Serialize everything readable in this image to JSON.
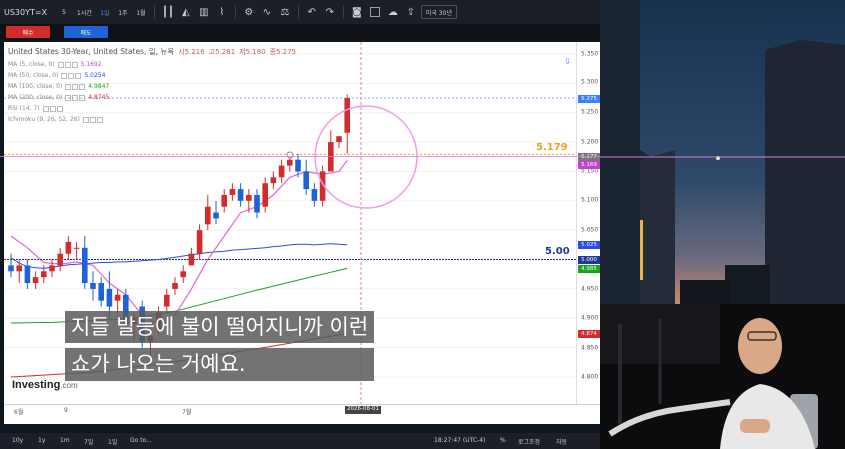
{
  "toolbar": {
    "symbol": "US30YT=X",
    "intervals": [
      "5",
      "1시간",
      "1일",
      "1주",
      "1월"
    ],
    "active_interval": "1일",
    "timezone": "미국 30년"
  },
  "trade": {
    "buy_label": "매수",
    "sell_label": "매도"
  },
  "legend": {
    "title": "United States 30-Year, United States, 일, 뉴욕",
    "open": "시5.216",
    "high": "고5.281",
    "low": "저5.180",
    "close": "종5.275",
    "indicators": [
      {
        "label": "MA (5, close, 0)",
        "value": "5.1692",
        "color": "#c33fd6"
      },
      {
        "label": "MA (50, close, 0)",
        "value": "5.0254",
        "color": "#2c4be0"
      },
      {
        "label": "MA (100, close, 0)",
        "value": "4.9847",
        "color": "#1aa31a"
      },
      {
        "label": "MA (200, close, 0)",
        "value": "4.8745",
        "color": "#d22c2c"
      },
      {
        "label": "RSI (14, 7)",
        "value": "",
        "color": "#888888"
      },
      {
        "label": "Ichimoku (9, 26, 52, 26)",
        "value": "",
        "color": "#888888"
      }
    ]
  },
  "price_axis": {
    "ticks": [
      "5.350",
      "5.300",
      "5.250",
      "5.200",
      "5.150",
      "5.100",
      "5.050",
      "4.950",
      "4.900",
      "4.850",
      "4.800"
    ],
    "badges": [
      {
        "value": "5.275",
        "color": "#3b82f6"
      },
      {
        "value": "5.177",
        "color": "#777777"
      },
      {
        "value": "5.169",
        "color": "#c33fd6"
      },
      {
        "value": "5.025",
        "color": "#2c4be0"
      },
      {
        "value": "5.000",
        "color": "#1f3a93"
      },
      {
        "value": "4.985",
        "color": "#1aa31a"
      },
      {
        "value": "4.874",
        "color": "#d22c2c"
      }
    ]
  },
  "levels": {
    "upper": "5.179",
    "lower": "5.00"
  },
  "time_axis": {
    "labels": [
      "6월",
      "9",
      "7월"
    ],
    "current_date": "2026-08-01"
  },
  "logo": {
    "brand": "Investing",
    "suffix": ".com"
  },
  "bottom": {
    "ranges": [
      "10y",
      "1y",
      "1m",
      "7일",
      "1일"
    ],
    "goto": "Go to...",
    "clock": "18:27:47 (UTC-4)",
    "percent": "%",
    "log": "로그조정",
    "auto": "자동"
  },
  "subtitles": [
    "지들 발등에 불이 떨어지니까 이런",
    "쇼가 나오는 거예요."
  ],
  "chart_data": {
    "type": "candlestick",
    "title": "United States 30-Year, United States, 일, 뉴욕",
    "y_range": [
      4.78,
      5.36
    ],
    "candles": [
      {
        "o": 4.99,
        "h": 5.01,
        "l": 4.97,
        "c": 4.98
      },
      {
        "o": 4.98,
        "h": 5.0,
        "l": 4.96,
        "c": 4.99
      },
      {
        "o": 4.99,
        "h": 5.0,
        "l": 4.95,
        "c": 4.96
      },
      {
        "o": 4.96,
        "h": 4.98,
        "l": 4.95,
        "c": 4.97
      },
      {
        "o": 4.97,
        "h": 4.99,
        "l": 4.96,
        "c": 4.98
      },
      {
        "o": 4.98,
        "h": 5.0,
        "l": 4.97,
        "c": 4.99
      },
      {
        "o": 4.99,
        "h": 5.02,
        "l": 4.98,
        "c": 5.01
      },
      {
        "o": 5.01,
        "h": 5.04,
        "l": 5.0,
        "c": 5.03
      },
      {
        "o": 5.02,
        "h": 5.03,
        "l": 5.0,
        "c": 5.02
      },
      {
        "o": 5.02,
        "h": 5.04,
        "l": 4.95,
        "c": 4.96
      },
      {
        "o": 4.96,
        "h": 4.98,
        "l": 4.93,
        "c": 4.95
      },
      {
        "o": 4.96,
        "h": 4.97,
        "l": 4.92,
        "c": 4.93
      },
      {
        "o": 4.95,
        "h": 4.98,
        "l": 4.9,
        "c": 4.92
      },
      {
        "o": 4.93,
        "h": 4.95,
        "l": 4.91,
        "c": 4.94
      },
      {
        "o": 4.94,
        "h": 4.95,
        "l": 4.88,
        "c": 4.89
      },
      {
        "o": 4.89,
        "h": 4.91,
        "l": 4.86,
        "c": 4.9
      },
      {
        "o": 4.92,
        "h": 4.93,
        "l": 4.85,
        "c": 4.86
      },
      {
        "o": 4.86,
        "h": 4.88,
        "l": 4.83,
        "c": 4.87
      },
      {
        "o": 4.88,
        "h": 4.92,
        "l": 4.87,
        "c": 4.91
      },
      {
        "o": 4.92,
        "h": 4.95,
        "l": 4.91,
        "c": 4.94
      },
      {
        "o": 4.95,
        "h": 4.97,
        "l": 4.94,
        "c": 4.96
      },
      {
        "o": 4.97,
        "h": 4.99,
        "l": 4.96,
        "c": 4.98
      },
      {
        "o": 4.99,
        "h": 5.02,
        "l": 4.99,
        "c": 5.01
      },
      {
        "o": 5.01,
        "h": 5.06,
        "l": 5.0,
        "c": 5.05
      },
      {
        "o": 5.06,
        "h": 5.11,
        "l": 5.05,
        "c": 5.09
      },
      {
        "o": 5.08,
        "h": 5.1,
        "l": 5.06,
        "c": 5.07
      },
      {
        "o": 5.09,
        "h": 5.12,
        "l": 5.08,
        "c": 5.11
      },
      {
        "o": 5.11,
        "h": 5.13,
        "l": 5.1,
        "c": 5.12
      },
      {
        "o": 5.12,
        "h": 5.13,
        "l": 5.09,
        "c": 5.1
      },
      {
        "o": 5.1,
        "h": 5.12,
        "l": 5.08,
        "c": 5.11
      },
      {
        "o": 5.11,
        "h": 5.12,
        "l": 5.07,
        "c": 5.08
      },
      {
        "o": 5.09,
        "h": 5.14,
        "l": 5.08,
        "c": 5.13
      },
      {
        "o": 5.13,
        "h": 5.15,
        "l": 5.12,
        "c": 5.14
      },
      {
        "o": 5.14,
        "h": 5.17,
        "l": 5.13,
        "c": 5.16
      },
      {
        "o": 5.16,
        "h": 5.18,
        "l": 5.15,
        "c": 5.17
      },
      {
        "o": 5.17,
        "h": 5.18,
        "l": 5.14,
        "c": 5.15
      },
      {
        "o": 5.15,
        "h": 5.17,
        "l": 5.11,
        "c": 5.12
      },
      {
        "o": 5.12,
        "h": 5.13,
        "l": 5.09,
        "c": 5.1
      },
      {
        "o": 5.1,
        "h": 5.16,
        "l": 5.09,
        "c": 5.15
      },
      {
        "o": 5.15,
        "h": 5.22,
        "l": 5.15,
        "c": 5.2
      },
      {
        "o": 5.2,
        "h": 5.21,
        "l": 5.19,
        "c": 5.21
      },
      {
        "o": 5.216,
        "h": 5.281,
        "l": 5.18,
        "c": 5.275
      }
    ],
    "ma": {
      "ma50": [
        [
          0,
          5.003
        ],
        [
          1,
          4.994
        ],
        [
          2,
          4.988
        ],
        [
          3,
          4.986
        ],
        [
          4,
          4.985
        ],
        [
          5,
          4.987
        ],
        [
          6,
          4.989
        ],
        [
          7,
          4.991
        ],
        [
          8,
          4.992
        ],
        [
          9,
          4.993
        ],
        [
          10,
          4.994
        ],
        [
          11,
          4.995
        ],
        [
          12,
          4.995
        ],
        [
          13,
          4.996
        ],
        [
          14,
          4.996
        ],
        [
          15,
          4.997
        ],
        [
          16,
          4.998
        ],
        [
          17,
          4.999
        ],
        [
          18,
          5.0
        ],
        [
          19,
          5.002
        ],
        [
          20,
          5.004
        ],
        [
          21,
          5.006
        ],
        [
          22,
          5.008
        ],
        [
          23,
          5.01
        ],
        [
          24,
          5.012
        ],
        [
          25,
          5.013
        ],
        [
          26,
          5.014
        ],
        [
          27,
          5.016
        ],
        [
          28,
          5.017
        ],
        [
          29,
          5.018
        ],
        [
          30,
          5.019
        ],
        [
          31,
          5.02
        ],
        [
          32,
          5.022
        ],
        [
          33,
          5.023
        ],
        [
          34,
          5.025
        ],
        [
          35,
          5.026
        ],
        [
          36,
          5.026
        ],
        [
          37,
          5.025
        ],
        [
          38,
          5.026
        ],
        [
          39,
          5.027
        ],
        [
          40,
          5.026
        ],
        [
          41,
          5.025
        ]
      ],
      "ma100": [
        [
          0,
          4.892
        ],
        [
          5,
          4.893
        ],
        [
          10,
          4.896
        ],
        [
          15,
          4.9
        ],
        [
          20,
          4.912
        ],
        [
          25,
          4.93
        ],
        [
          30,
          4.948
        ],
        [
          35,
          4.965
        ],
        [
          38,
          4.975
        ],
        [
          41,
          4.985
        ]
      ],
      "ma200": [
        [
          0,
          4.8
        ],
        [
          10,
          4.808
        ],
        [
          20,
          4.826
        ],
        [
          30,
          4.848
        ],
        [
          41,
          4.874
        ]
      ],
      "ma5": [
        [
          0,
          5.04
        ],
        [
          2,
          5.02
        ],
        [
          4,
          4.995
        ],
        [
          6,
          4.992
        ],
        [
          8,
          4.996
        ],
        [
          10,
          4.99
        ],
        [
          12,
          4.96
        ],
        [
          14,
          4.94
        ],
        [
          16,
          4.905
        ],
        [
          18,
          4.89
        ],
        [
          20,
          4.905
        ],
        [
          22,
          4.95
        ],
        [
          24,
          5.0
        ],
        [
          26,
          5.04
        ],
        [
          28,
          5.08
        ],
        [
          30,
          5.09
        ],
        [
          32,
          5.11
        ],
        [
          34,
          5.14
        ],
        [
          36,
          5.15
        ],
        [
          38,
          5.145
        ],
        [
          40,
          5.15
        ],
        [
          41,
          5.169
        ]
      ]
    },
    "levels": [
      5.179,
      5.0
    ]
  }
}
